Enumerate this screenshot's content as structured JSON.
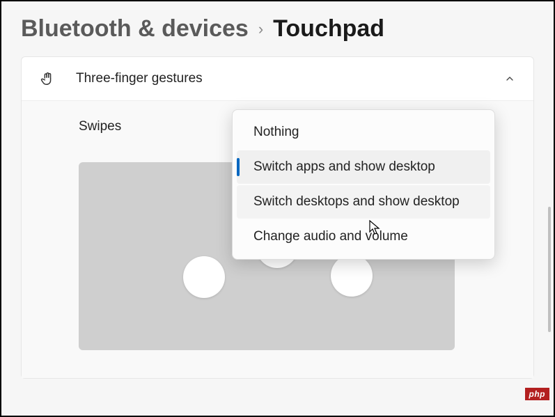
{
  "breadcrumb": {
    "parent": "Bluetooth & devices",
    "current": "Touchpad"
  },
  "panel": {
    "title": "Three-finger gestures"
  },
  "row": {
    "label": "Swipes"
  },
  "dropdown": {
    "items": [
      {
        "label": "Nothing"
      },
      {
        "label": "Switch apps and show desktop"
      },
      {
        "label": "Switch desktops and show desktop"
      },
      {
        "label": "Change audio and volume"
      }
    ]
  },
  "watermark": "php"
}
